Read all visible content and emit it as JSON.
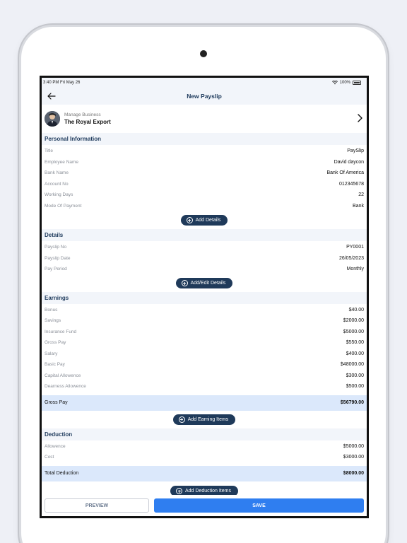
{
  "status_bar": {
    "time": "3:40 PM",
    "date": "Fri May 26",
    "battery": "100%"
  },
  "nav": {
    "title": "New Payslip"
  },
  "business": {
    "caption": "Manage Business",
    "name": "The Royal Export"
  },
  "personal": {
    "heading": "Personal Information",
    "rows": [
      {
        "label": "Title",
        "value": "PaySlip"
      },
      {
        "label": "Employee Name",
        "value": "David daycon"
      },
      {
        "label": "Bank Name",
        "value": "Bank Of America"
      },
      {
        "label": "Account No",
        "value": "012345678"
      },
      {
        "label": "Working Days",
        "value": "22"
      },
      {
        "label": "Mode Of Payment",
        "value": "Bank"
      }
    ],
    "button": "Add Details"
  },
  "details": {
    "heading": "Details",
    "rows": [
      {
        "label": "Payslip No",
        "value": "PY0001"
      },
      {
        "label": "Payslip Date",
        "value": "26/05/2023"
      },
      {
        "label": "Pay Period",
        "value": "Monthly"
      }
    ],
    "button": "Add/Edit Details"
  },
  "earnings": {
    "heading": "Earnings",
    "rows": [
      {
        "label": "Bonus",
        "value": "$40.00"
      },
      {
        "label": "Savings",
        "value": "$2000.00"
      },
      {
        "label": "Insurance Fund",
        "value": "$5000.00"
      },
      {
        "label": "Gross Pay",
        "value": "$550.00"
      },
      {
        "label": "Salary",
        "value": "$400.00"
      },
      {
        "label": "Basic Pay",
        "value": "$48000.00"
      },
      {
        "label": "Capital Allowence",
        "value": "$300.00"
      },
      {
        "label": "Dearness Allowence",
        "value": "$500.00"
      }
    ],
    "total_label": "Gross Pay",
    "total_value": "$56790.00",
    "button": "Add Earning Items"
  },
  "deduction": {
    "heading": "Deduction",
    "rows": [
      {
        "label": "Allowence",
        "value": "$5000.00"
      },
      {
        "label": "Cost",
        "value": "$3000.00"
      }
    ],
    "total_label": "Total Deduction",
    "total_value": "$8000.00",
    "button": "Add Deduction Items"
  },
  "footer": {
    "preview": "PREVIEW",
    "save": "SAVE"
  }
}
